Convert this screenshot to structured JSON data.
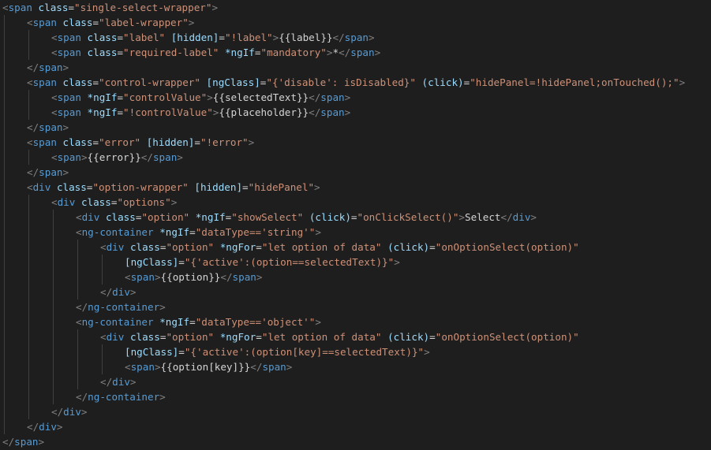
{
  "editor": {
    "language": "html",
    "theme": "dark",
    "colors": {
      "background": "#1e1e1e",
      "tag": "#569cd6",
      "attribute": "#9cdcfe",
      "string": "#ce9178",
      "punctuation": "#808080",
      "text": "#d4d4d4",
      "indent_guide": "#404040"
    },
    "lines": [
      {
        "indent": 0,
        "tokens": [
          [
            "punc",
            "<"
          ],
          [
            "tag",
            "span"
          ],
          [
            "text",
            " "
          ],
          [
            "attr",
            "class"
          ],
          [
            "text",
            "="
          ],
          [
            "str",
            "\"single-select-wrapper\""
          ],
          [
            "punc",
            ">"
          ]
        ]
      },
      {
        "indent": 1,
        "tokens": [
          [
            "punc",
            "<"
          ],
          [
            "tag",
            "span"
          ],
          [
            "text",
            " "
          ],
          [
            "attr",
            "class"
          ],
          [
            "text",
            "="
          ],
          [
            "str",
            "\"label-wrapper\""
          ],
          [
            "punc",
            ">"
          ]
        ]
      },
      {
        "indent": 2,
        "tokens": [
          [
            "punc",
            "<"
          ],
          [
            "tag",
            "span"
          ],
          [
            "text",
            " "
          ],
          [
            "attr",
            "class"
          ],
          [
            "text",
            "="
          ],
          [
            "str",
            "\"label\""
          ],
          [
            "text",
            " "
          ],
          [
            "attr",
            "[hidden]"
          ],
          [
            "text",
            "="
          ],
          [
            "str",
            "\"!label\""
          ],
          [
            "punc",
            ">"
          ],
          [
            "text",
            "{{label}}"
          ],
          [
            "punc",
            "</"
          ],
          [
            "tag",
            "span"
          ],
          [
            "punc",
            ">"
          ]
        ]
      },
      {
        "indent": 2,
        "tokens": [
          [
            "punc",
            "<"
          ],
          [
            "tag",
            "span"
          ],
          [
            "text",
            " "
          ],
          [
            "attr",
            "class"
          ],
          [
            "text",
            "="
          ],
          [
            "str",
            "\"required-label\""
          ],
          [
            "text",
            " "
          ],
          [
            "attr",
            "*ngIf"
          ],
          [
            "text",
            "="
          ],
          [
            "str",
            "\"mandatory\""
          ],
          [
            "punc",
            ">"
          ],
          [
            "text",
            "*"
          ],
          [
            "punc",
            "</"
          ],
          [
            "tag",
            "span"
          ],
          [
            "punc",
            ">"
          ]
        ]
      },
      {
        "indent": 1,
        "tokens": [
          [
            "punc",
            "</"
          ],
          [
            "tag",
            "span"
          ],
          [
            "punc",
            ">"
          ]
        ]
      },
      {
        "indent": 1,
        "tokens": [
          [
            "punc",
            "<"
          ],
          [
            "tag",
            "span"
          ],
          [
            "text",
            " "
          ],
          [
            "attr",
            "class"
          ],
          [
            "text",
            "="
          ],
          [
            "str",
            "\"control-wrapper\""
          ],
          [
            "text",
            " "
          ],
          [
            "attr",
            "[ngClass]"
          ],
          [
            "text",
            "="
          ],
          [
            "str",
            "\"{'disable': isDisabled}\""
          ],
          [
            "text",
            " "
          ],
          [
            "attr",
            "(click)"
          ],
          [
            "text",
            "="
          ],
          [
            "str",
            "\"hidePanel=!hidePanel;onTouched();\""
          ],
          [
            "punc",
            ">"
          ]
        ]
      },
      {
        "indent": 2,
        "tokens": [
          [
            "punc",
            "<"
          ],
          [
            "tag",
            "span"
          ],
          [
            "text",
            " "
          ],
          [
            "attr",
            "*ngIf"
          ],
          [
            "text",
            "="
          ],
          [
            "str",
            "\"controlValue\""
          ],
          [
            "punc",
            ">"
          ],
          [
            "text",
            "{{selectedText}}"
          ],
          [
            "punc",
            "</"
          ],
          [
            "tag",
            "span"
          ],
          [
            "punc",
            ">"
          ]
        ]
      },
      {
        "indent": 2,
        "tokens": [
          [
            "punc",
            "<"
          ],
          [
            "tag",
            "span"
          ],
          [
            "text",
            " "
          ],
          [
            "attr",
            "*ngIf"
          ],
          [
            "text",
            "="
          ],
          [
            "str",
            "\"!controlValue\""
          ],
          [
            "punc",
            ">"
          ],
          [
            "text",
            "{{placeholder}}"
          ],
          [
            "punc",
            "</"
          ],
          [
            "tag",
            "span"
          ],
          [
            "punc",
            ">"
          ]
        ]
      },
      {
        "indent": 1,
        "tokens": [
          [
            "punc",
            "</"
          ],
          [
            "tag",
            "span"
          ],
          [
            "punc",
            ">"
          ]
        ]
      },
      {
        "indent": 1,
        "tokens": [
          [
            "punc",
            "<"
          ],
          [
            "tag",
            "span"
          ],
          [
            "text",
            " "
          ],
          [
            "attr",
            "class"
          ],
          [
            "text",
            "="
          ],
          [
            "str",
            "\"error\""
          ],
          [
            "text",
            " "
          ],
          [
            "attr",
            "[hidden]"
          ],
          [
            "text",
            "="
          ],
          [
            "str",
            "\"!error\""
          ],
          [
            "punc",
            ">"
          ]
        ]
      },
      {
        "indent": 2,
        "tokens": [
          [
            "punc",
            "<"
          ],
          [
            "tag",
            "span"
          ],
          [
            "punc",
            ">"
          ],
          [
            "text",
            "{{error}}"
          ],
          [
            "punc",
            "</"
          ],
          [
            "tag",
            "span"
          ],
          [
            "punc",
            ">"
          ]
        ]
      },
      {
        "indent": 1,
        "tokens": [
          [
            "punc",
            "</"
          ],
          [
            "tag",
            "span"
          ],
          [
            "punc",
            ">"
          ]
        ]
      },
      {
        "indent": 1,
        "tokens": [
          [
            "punc",
            "<"
          ],
          [
            "tag",
            "div"
          ],
          [
            "text",
            " "
          ],
          [
            "attr",
            "class"
          ],
          [
            "text",
            "="
          ],
          [
            "str",
            "\"option-wrapper\""
          ],
          [
            "text",
            " "
          ],
          [
            "attr",
            "[hidden]"
          ],
          [
            "text",
            "="
          ],
          [
            "str",
            "\"hidePanel\""
          ],
          [
            "punc",
            ">"
          ]
        ]
      },
      {
        "indent": 2,
        "tokens": [
          [
            "punc",
            "<"
          ],
          [
            "tag",
            "div"
          ],
          [
            "text",
            " "
          ],
          [
            "attr",
            "class"
          ],
          [
            "text",
            "="
          ],
          [
            "str",
            "\"options\""
          ],
          [
            "punc",
            ">"
          ]
        ]
      },
      {
        "indent": 3,
        "tokens": [
          [
            "punc",
            "<"
          ],
          [
            "tag",
            "div"
          ],
          [
            "text",
            " "
          ],
          [
            "attr",
            "class"
          ],
          [
            "text",
            "="
          ],
          [
            "str",
            "\"option\""
          ],
          [
            "text",
            " "
          ],
          [
            "attr",
            "*ngIf"
          ],
          [
            "text",
            "="
          ],
          [
            "str",
            "\"showSelect\""
          ],
          [
            "text",
            " "
          ],
          [
            "attr",
            "(click)"
          ],
          [
            "text",
            "="
          ],
          [
            "str",
            "\"onClickSelect()\""
          ],
          [
            "punc",
            ">"
          ],
          [
            "text",
            "Select"
          ],
          [
            "punc",
            "</"
          ],
          [
            "tag",
            "div"
          ],
          [
            "punc",
            ">"
          ]
        ]
      },
      {
        "indent": 3,
        "tokens": [
          [
            "punc",
            "<"
          ],
          [
            "tag",
            "ng-container"
          ],
          [
            "text",
            " "
          ],
          [
            "attr",
            "*ngIf"
          ],
          [
            "text",
            "="
          ],
          [
            "str",
            "\"dataType=='string'\""
          ],
          [
            "punc",
            ">"
          ]
        ]
      },
      {
        "indent": 4,
        "tokens": [
          [
            "punc",
            "<"
          ],
          [
            "tag",
            "div"
          ],
          [
            "text",
            " "
          ],
          [
            "attr",
            "class"
          ],
          [
            "text",
            "="
          ],
          [
            "str",
            "\"option\""
          ],
          [
            "text",
            " "
          ],
          [
            "attr",
            "*ngFor"
          ],
          [
            "text",
            "="
          ],
          [
            "str",
            "\"let option of data\""
          ],
          [
            "text",
            " "
          ],
          [
            "attr",
            "(click)"
          ],
          [
            "text",
            "="
          ],
          [
            "str",
            "\"onOptionSelect(option)\""
          ]
        ]
      },
      {
        "indent": 5,
        "tokens": [
          [
            "attr",
            "[ngClass]"
          ],
          [
            "text",
            "="
          ],
          [
            "str",
            "\"{'active':(option==selectedText)}\""
          ],
          [
            "punc",
            ">"
          ]
        ]
      },
      {
        "indent": 5,
        "tokens": [
          [
            "punc",
            "<"
          ],
          [
            "tag",
            "span"
          ],
          [
            "punc",
            ">"
          ],
          [
            "text",
            "{{option}}"
          ],
          [
            "punc",
            "</"
          ],
          [
            "tag",
            "span"
          ],
          [
            "punc",
            ">"
          ]
        ]
      },
      {
        "indent": 4,
        "tokens": [
          [
            "punc",
            "</"
          ],
          [
            "tag",
            "div"
          ],
          [
            "punc",
            ">"
          ]
        ]
      },
      {
        "indent": 3,
        "tokens": [
          [
            "punc",
            "</"
          ],
          [
            "tag",
            "ng-container"
          ],
          [
            "punc",
            ">"
          ]
        ]
      },
      {
        "indent": 3,
        "tokens": [
          [
            "punc",
            "<"
          ],
          [
            "tag",
            "ng-container"
          ],
          [
            "text",
            " "
          ],
          [
            "attr",
            "*ngIf"
          ],
          [
            "text",
            "="
          ],
          [
            "str",
            "\"dataType=='object'\""
          ],
          [
            "punc",
            ">"
          ]
        ]
      },
      {
        "indent": 4,
        "tokens": [
          [
            "punc",
            "<"
          ],
          [
            "tag",
            "div"
          ],
          [
            "text",
            " "
          ],
          [
            "attr",
            "class"
          ],
          [
            "text",
            "="
          ],
          [
            "str",
            "\"option\""
          ],
          [
            "text",
            " "
          ],
          [
            "attr",
            "*ngFor"
          ],
          [
            "text",
            "="
          ],
          [
            "str",
            "\"let option of data\""
          ],
          [
            "text",
            " "
          ],
          [
            "attr",
            "(click)"
          ],
          [
            "text",
            "="
          ],
          [
            "str",
            "\"onOptionSelect(option)\""
          ]
        ]
      },
      {
        "indent": 5,
        "tokens": [
          [
            "attr",
            "[ngClass]"
          ],
          [
            "text",
            "="
          ],
          [
            "str",
            "\"{'active':(option[key]==selectedText)}\""
          ],
          [
            "punc",
            ">"
          ]
        ]
      },
      {
        "indent": 5,
        "tokens": [
          [
            "punc",
            "<"
          ],
          [
            "tag",
            "span"
          ],
          [
            "punc",
            ">"
          ],
          [
            "text",
            "{{option[key]}}"
          ],
          [
            "punc",
            "</"
          ],
          [
            "tag",
            "span"
          ],
          [
            "punc",
            ">"
          ]
        ]
      },
      {
        "indent": 4,
        "tokens": [
          [
            "punc",
            "</"
          ],
          [
            "tag",
            "div"
          ],
          [
            "punc",
            ">"
          ]
        ]
      },
      {
        "indent": 3,
        "tokens": [
          [
            "punc",
            "</"
          ],
          [
            "tag",
            "ng-container"
          ],
          [
            "punc",
            ">"
          ]
        ]
      },
      {
        "indent": 2,
        "tokens": [
          [
            "punc",
            "</"
          ],
          [
            "tag",
            "div"
          ],
          [
            "punc",
            ">"
          ]
        ]
      },
      {
        "indent": 1,
        "tokens": [
          [
            "punc",
            "</"
          ],
          [
            "tag",
            "div"
          ],
          [
            "punc",
            ">"
          ]
        ]
      },
      {
        "indent": 0,
        "tokens": [
          [
            "punc",
            "</"
          ],
          [
            "tag",
            "span"
          ],
          [
            "punc",
            ">"
          ]
        ]
      }
    ]
  }
}
